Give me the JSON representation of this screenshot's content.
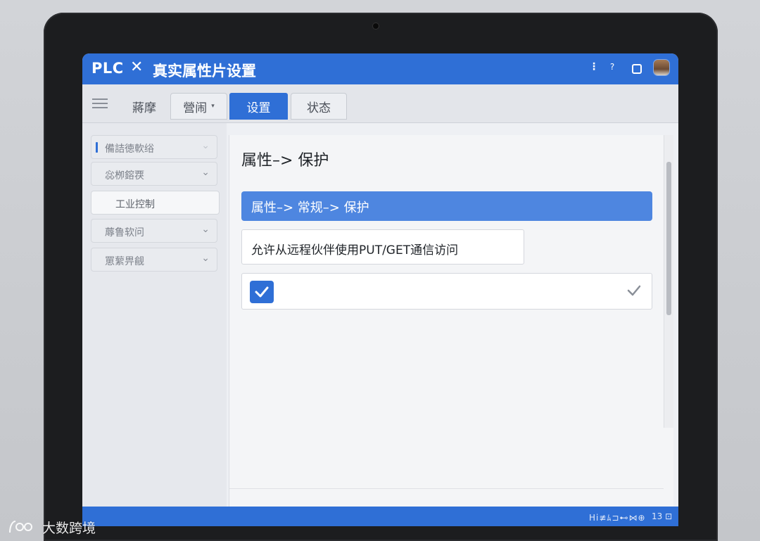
{
  "window": {
    "app_name": "PLC",
    "separator": "✕",
    "title": "真实属性片设置",
    "kebab_icon": "⋮",
    "help_icon": "?"
  },
  "tabs": [
    {
      "label": "蔣摩",
      "active": false
    },
    {
      "label": "營闹",
      "active": false,
      "has_dropdown": true,
      "caret": "▾"
    },
    {
      "label": "设置",
      "active": true
    },
    {
      "label": "状态",
      "active": false
    }
  ],
  "sidebar": {
    "items": [
      {
        "label": "備詰徳軟绤",
        "chevron": "⌄",
        "selected": true
      },
      {
        "label": "惢栁鎔覄",
        "chevron": "⌄"
      },
      {
        "label": "工业控制",
        "active": true
      },
      {
        "label": "蓐鲁软问",
        "chevron": "⌄"
      },
      {
        "label": "罳蕠畀觎",
        "chevron": "⌄"
      }
    ]
  },
  "main": {
    "title": "属性–> 保护",
    "section_header": "属性–> 常规–> 保护",
    "option_label": "允许从远程伙伴使用PUT/GET通信访问",
    "checkbox_checked": true
  },
  "status_bar": {
    "text": "Hi≢ﾑ⊐⊷⋈⊕",
    "number": "13 ⊡"
  },
  "watermark": {
    "text": "大数跨境"
  },
  "colors": {
    "accent": "#2f6fd6",
    "section_header": "#4e86e0",
    "device_bezel": "#1c1d1f"
  }
}
